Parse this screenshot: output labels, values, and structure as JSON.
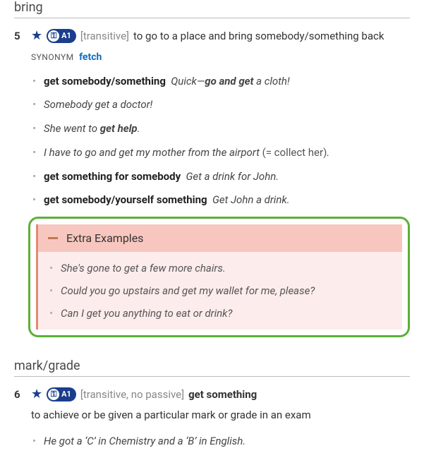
{
  "sections": {
    "s5": {
      "heading": "bring"
    },
    "s6": {
      "heading": "mark/grade"
    }
  },
  "badge": {
    "key_glyph": "⚿",
    "level": "A1"
  },
  "sense5": {
    "num": "5",
    "grammar": "[transitive]",
    "definition": "to go to a place and bring somebody/something back",
    "synonym_label": "SYNONYM",
    "synonym": "fetch",
    "examples": [
      {
        "pattern": "get somebody/something",
        "pre": "Quick—",
        "bold": "go and get",
        "post": " a cloth!"
      },
      {
        "text": "Somebody get a doctor!"
      },
      {
        "pre": "She went to ",
        "bold": "get help",
        "post": "."
      },
      {
        "text": "I have to go and get my mother from the airport ",
        "gloss": "(= collect her)",
        "post2": "."
      },
      {
        "pattern": "get something for somebody",
        "text": "Get a drink for John."
      },
      {
        "pattern": "get somebody/yourself something",
        "text": "Get John a drink."
      }
    ],
    "extra": {
      "title": "Extra Examples",
      "items": [
        "She's gone to get a few more chairs.",
        "Could you go upstairs and get my wallet for me, please?",
        "Can I get you anything to eat or drink?"
      ]
    }
  },
  "sense6": {
    "num": "6",
    "grammar": "[transitive, no passive]",
    "pattern": "get something",
    "definition": "to achieve or be given a particular mark or grade in an exam",
    "examples": [
      {
        "text": "He got a ‘C’ in Chemistry and a ‘B’ in English."
      }
    ]
  }
}
